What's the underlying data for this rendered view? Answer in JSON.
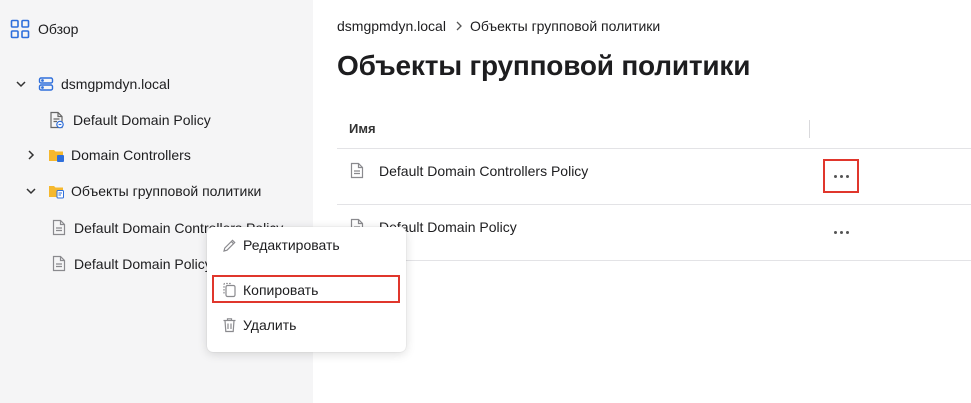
{
  "sidebar": {
    "overview_label": "Обзор",
    "tree": {
      "domain": "dsmgpmdyn.local",
      "default_domain_policy": "Default Domain Policy",
      "domain_controllers": "Domain Controllers",
      "gpo_folder": "Объекты групповой политики",
      "gpo_items": [
        "Default Domain Controllers Policy",
        "Default Domain Policy"
      ]
    }
  },
  "main": {
    "breadcrumb": {
      "domain": "dsmgpmdyn.local",
      "current": "Объекты групповой политики"
    },
    "title": "Объекты групповой политики",
    "table": {
      "column_name": "Имя",
      "rows": [
        {
          "name": "Default Domain Controllers Policy"
        },
        {
          "name": "Default Domain Policy"
        }
      ]
    }
  },
  "context_menu": {
    "edit": "Редактировать",
    "copy": "Копировать",
    "delete": "Удалить"
  },
  "colors": {
    "highlight": "#e0362c",
    "accent": "#2f6fdb",
    "folder": "#f5b82e"
  }
}
